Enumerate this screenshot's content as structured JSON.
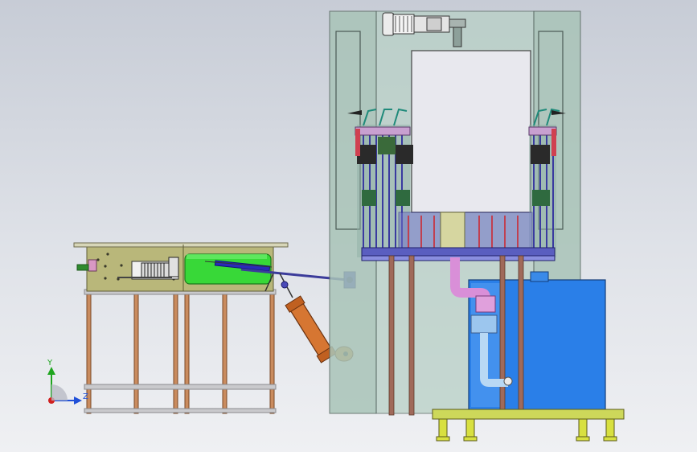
{
  "viewport": {
    "background_top": "#c7ccd6",
    "background_bottom": "#eff0f3"
  },
  "triad": {
    "y_label": "Y",
    "z_label": "Z",
    "y_color": "#1fa51f",
    "z_color": "#2050d8",
    "x_color": "#d02020"
  },
  "colors": {
    "frame_glass": "#a9c4b8",
    "frame_edge": "#6a7a74",
    "conveyor_deck": "#b9b77a",
    "leg": "#c98b5e",
    "green_tank": "#38d838",
    "orange_cylinder": "#d67632",
    "water_tank": "#2a7fe8",
    "pink_pipe": "#d98fd8",
    "light_blue_pipe": "#9cc6ee",
    "panel": "#e8e8ee",
    "base_frame": "#cdd85a",
    "blue_parts": "#4a4ab8"
  }
}
